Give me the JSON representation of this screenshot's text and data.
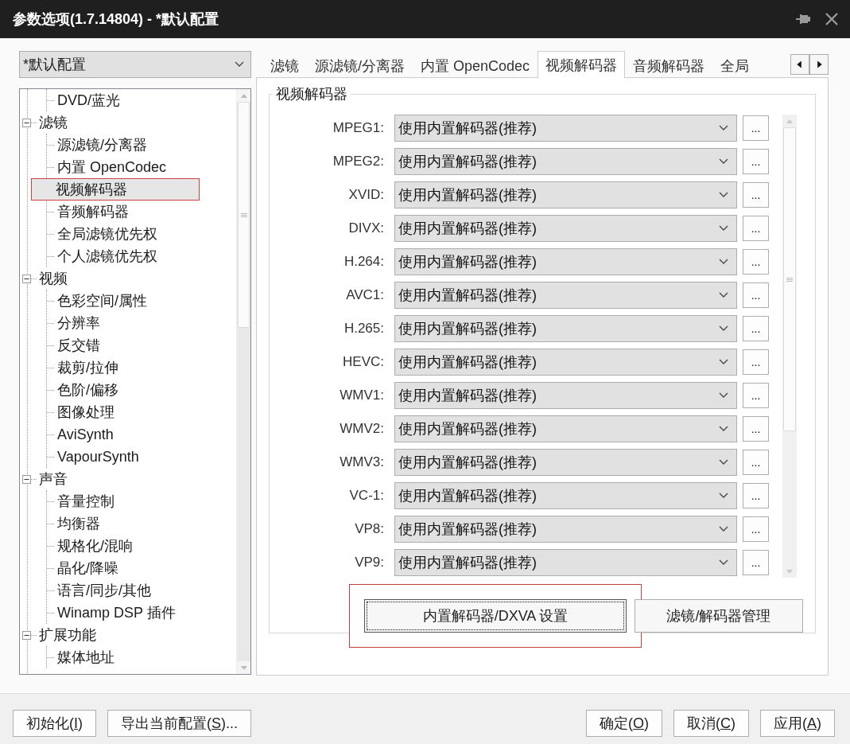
{
  "window": {
    "title": "参数选项(1.7.14804) - *默认配置"
  },
  "profile": {
    "value": "*默认配置"
  },
  "tree": {
    "items": [
      {
        "children": [
          {
            "label": "DVD/蓝光",
            "selected": false,
            "annotated": false
          }
        ]
      },
      {
        "label": "滤镜",
        "expanded": true,
        "children": [
          {
            "label": "源滤镜/分离器",
            "selected": false,
            "annotated": false
          },
          {
            "label": "内置 OpenCodec",
            "selected": false,
            "annotated": false
          },
          {
            "label": "视频解码器",
            "selected": true,
            "annotated": true
          },
          {
            "label": "音频解码器",
            "selected": false,
            "annotated": false
          },
          {
            "label": "全局滤镜优先权",
            "selected": false,
            "annotated": false
          },
          {
            "label": "个人滤镜优先权",
            "selected": false,
            "annotated": false
          }
        ]
      },
      {
        "label": "视频",
        "expanded": true,
        "children": [
          {
            "label": "色彩空间/属性",
            "selected": false,
            "annotated": false
          },
          {
            "label": "分辨率",
            "selected": false,
            "annotated": false
          },
          {
            "label": "反交错",
            "selected": false,
            "annotated": false
          },
          {
            "label": "裁剪/拉伸",
            "selected": false,
            "annotated": false
          },
          {
            "label": "色阶/偏移",
            "selected": false,
            "annotated": false
          },
          {
            "label": "图像处理",
            "selected": false,
            "annotated": false
          },
          {
            "label": "AviSynth",
            "selected": false,
            "annotated": false
          },
          {
            "label": "VapourSynth",
            "selected": false,
            "annotated": false
          }
        ]
      },
      {
        "label": "声音",
        "expanded": true,
        "children": [
          {
            "label": "音量控制",
            "selected": false,
            "annotated": false
          },
          {
            "label": "均衡器",
            "selected": false,
            "annotated": false
          },
          {
            "label": "规格化/混响",
            "selected": false,
            "annotated": false
          },
          {
            "label": "晶化/降噪",
            "selected": false,
            "annotated": false
          },
          {
            "label": "语言/同步/其他",
            "selected": false,
            "annotated": false
          },
          {
            "label": "Winamp DSP 插件",
            "selected": false,
            "annotated": false
          }
        ]
      },
      {
        "label": "扩展功能",
        "expanded": true,
        "children": [
          {
            "label": "媒体地址",
            "selected": false,
            "annotated": false
          }
        ]
      }
    ]
  },
  "tabs": [
    {
      "label": "滤镜",
      "selected": false
    },
    {
      "label": "源滤镜/分离器",
      "selected": false
    },
    {
      "label": "内置 OpenCodec",
      "selected": false
    },
    {
      "label": "视频解码器",
      "selected": true
    },
    {
      "label": "音频解码器",
      "selected": false
    },
    {
      "label": "全局",
      "selected": false
    }
  ],
  "group": {
    "title": "视频解码器",
    "rows": [
      {
        "label": "MPEG1:",
        "value": "使用内置解码器(推荐)",
        "button": "..."
      },
      {
        "label": "MPEG2:",
        "value": "使用内置解码器(推荐)",
        "button": "..."
      },
      {
        "label": "XVID:",
        "value": "使用内置解码器(推荐)",
        "button": "..."
      },
      {
        "label": "DIVX:",
        "value": "使用内置解码器(推荐)",
        "button": "..."
      },
      {
        "label": "H.264:",
        "value": "使用内置解码器(推荐)",
        "button": "..."
      },
      {
        "label": "AVC1:",
        "value": "使用内置解码器(推荐)",
        "button": "..."
      },
      {
        "label": "H.265:",
        "value": "使用内置解码器(推荐)",
        "button": "..."
      },
      {
        "label": "HEVC:",
        "value": "使用内置解码器(推荐)",
        "button": "..."
      },
      {
        "label": "WMV1:",
        "value": "使用内置解码器(推荐)",
        "button": "..."
      },
      {
        "label": "WMV2:",
        "value": "使用内置解码器(推荐)",
        "button": "..."
      },
      {
        "label": "WMV3:",
        "value": "使用内置解码器(推荐)",
        "button": "..."
      },
      {
        "label": "VC-1:",
        "value": "使用内置解码器(推荐)",
        "button": "..."
      },
      {
        "label": "VP8:",
        "value": "使用内置解码器(推荐)",
        "button": "..."
      },
      {
        "label": "VP9:",
        "value": "使用内置解码器(推荐)",
        "button": "..."
      }
    ],
    "buttons": [
      {
        "label": "内置解码器/DXVA 设置",
        "focused": true,
        "annotated": true
      },
      {
        "label": "滤镜/解码器管理",
        "focused": false,
        "annotated": false
      }
    ]
  },
  "footer": {
    "left": [
      {
        "text": "初始化(",
        "key": "I",
        "tail": ")"
      },
      {
        "text": "导出当前配置(",
        "key": "S",
        "tail": ")..."
      }
    ],
    "right": [
      {
        "text": "确定(",
        "key": "O",
        "tail": ")"
      },
      {
        "text": "取消(",
        "key": "C",
        "tail": ")"
      },
      {
        "text": "应用(",
        "key": "A",
        "tail": ")"
      }
    ]
  }
}
